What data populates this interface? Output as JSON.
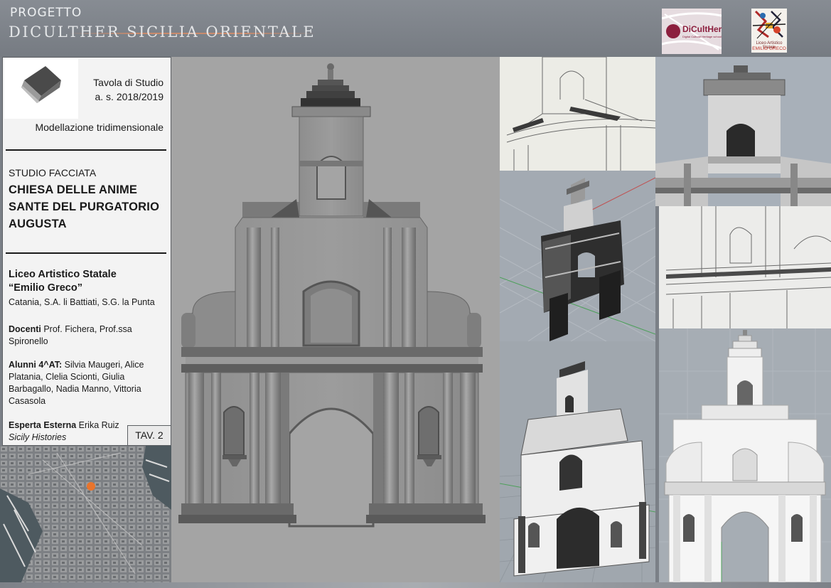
{
  "header": {
    "project_label": "PROGETTO",
    "project_title": "DICULTHER SICILIA ORIENTALE",
    "logos": {
      "dicult": {
        "name": "DiCultHer",
        "tagline": "Digital Cultural Heritage school"
      },
      "liceo": {
        "line1": "Liceo Artistico Statale",
        "line2": "EMILIO GRECO"
      }
    }
  },
  "info_panel": {
    "icon": "cube-icon",
    "tavola": "Tavola di Studio",
    "year": "a. s. 2018/2019",
    "subject": "Modellazione tridimensionale",
    "studio": "STUDIO FACCIATA",
    "church_lines": [
      "CHIESA DELLE ANIME",
      "SANTE DEL PURGATORIO",
      "AUGUSTA"
    ],
    "school_name_l1": "Liceo Artistico Statale",
    "school_name_l2": "“Emilio Greco”",
    "school_sites": "Catania, S.A. li Battiati, S.G. la Punta",
    "docenti_label": "Docenti",
    "docenti_value": "Prof. Fichera, Prof.ssa Spironello",
    "alunni_label": "Alunni 4^AT:",
    "alunni_value": "Silvia Maugeri, Alice Platania, Clelia Scionti, Giulia Barbagallo, Nadia Manno, Vittoria Casasola",
    "esperta_label": "Esperta Esterna",
    "esperta_value": "Erika Ruiz",
    "esperta_org": "Sicily Histories",
    "tav_badge": "TAV. 2"
  },
  "colors": {
    "header_bg": "#80858c",
    "panel_bg": "#f3f3f3",
    "accent_line": "#c98a6c",
    "map_marker": "#e8742c",
    "dicult_brand": "#8c1f3e"
  }
}
